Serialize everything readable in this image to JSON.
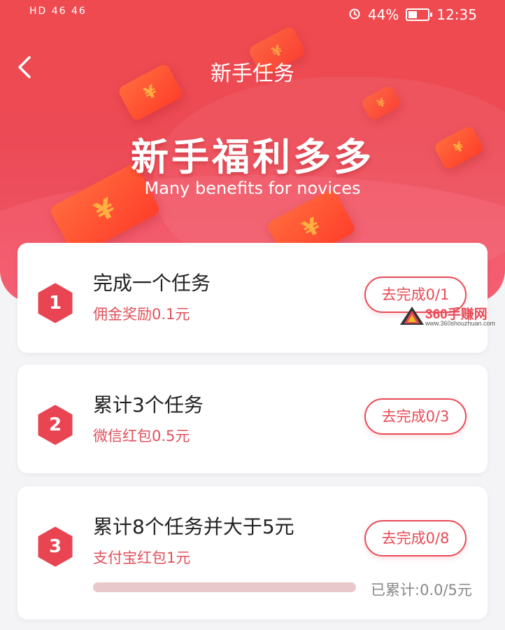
{
  "status_bar": {
    "left_indicators": "HD 46 46",
    "battery": "44%",
    "time": "12:35",
    "icons": [
      "signal-icon",
      "wifi-icon",
      "eye-icon",
      "alarm-icon",
      "battery-icon"
    ]
  },
  "nav": {
    "back_icon": "chevron-left-icon",
    "title": "新手任务"
  },
  "hero": {
    "title": "新手福利多多",
    "subtitle": "Many benefits for novices",
    "decoration": "red-envelope-icons"
  },
  "tasks": [
    {
      "number": "1",
      "title": "完成一个任务",
      "reward": "佣金奖励0.1元",
      "button_label": "去完成0/1"
    },
    {
      "number": "2",
      "title": "累计3个任务",
      "reward": "微信红包0.5元",
      "button_label": "去完成0/3"
    },
    {
      "number": "3",
      "title": "累计8个任务并大于5元",
      "reward": "支付宝红包1元",
      "button_label": "去完成0/8",
      "progress_text": "已累计:0.0/5元",
      "progress_fraction": 0
    }
  ],
  "watermark": {
    "brand": "360手赚网",
    "url": "www.360shouzhuan.com"
  },
  "colors": {
    "brand_red": "#e84b57",
    "hero_red": "#ef4a4f",
    "progress_track": "#e8c8cb"
  }
}
